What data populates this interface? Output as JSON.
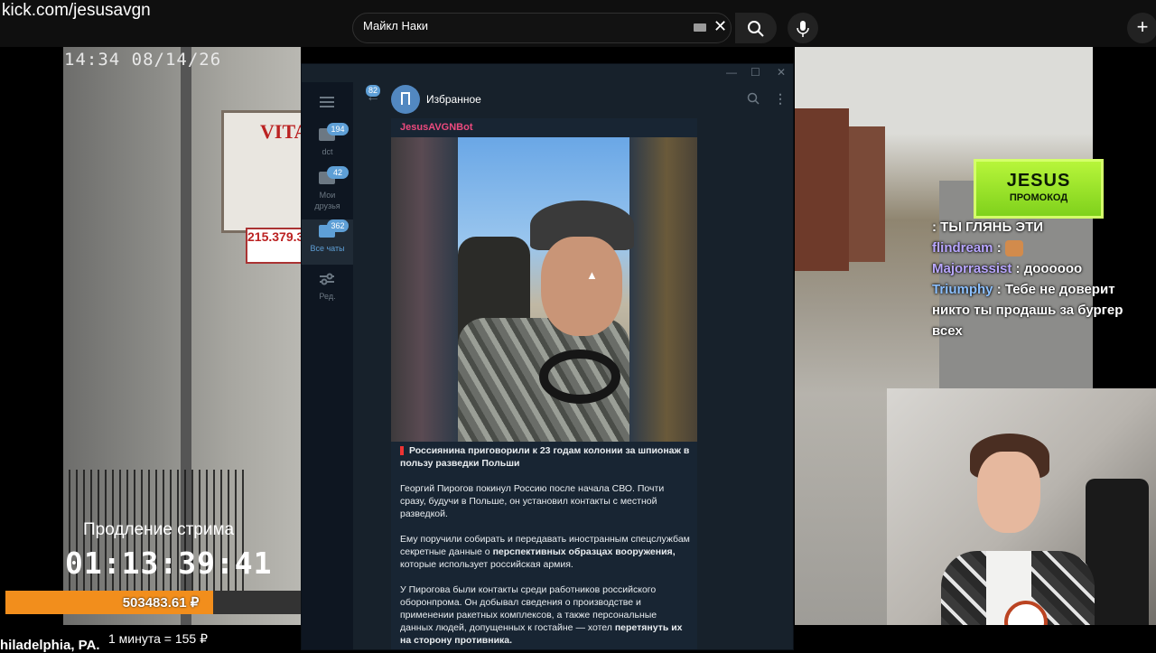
{
  "browser": {
    "url": "kick.com/jesusavgn",
    "search_value": "Майкл Наки"
  },
  "stream": {
    "timestamp": "14:34  08/14/26",
    "sign_text": "VITA\nH",
    "phone_sign": "215.379.3",
    "prolong_label": "Продление стрима",
    "prolong_timer": "01:13:39:41",
    "donation_amount": "503483.61 ₽",
    "donation_progress": 0.67,
    "location": "hiladelphia, PA.",
    "rate": "1 минута = 155 ₽",
    "accent": "#f28e1c"
  },
  "promo": {
    "title": "JESUS",
    "subtitle": "ПРОМОКОД"
  },
  "chat": {
    "lines": [
      {
        "user": "",
        "message": ": ТЫ ГЛЯНЬ ЭТИ"
      },
      {
        "user": "flindream",
        "message": ":"
      },
      {
        "user": "Majorrassist",
        "message": ": дoooooo"
      },
      {
        "user": "Triumphy",
        "message": ": Тебе не доверит никто ты продашь за бургер всех"
      }
    ]
  },
  "telegram": {
    "folders": [
      {
        "label": "dct",
        "badge": "194"
      },
      {
        "label": "Мои друзья",
        "badge": "42"
      },
      {
        "label": "Все чаты",
        "badge": "362"
      },
      {
        "label": "Ред.",
        "badge": ""
      }
    ],
    "back_badge": "82",
    "chat_title": "Избранное",
    "message": {
      "sender": "JesusAVGNBot",
      "headline": "Россиянина приговорили к 23 годам колонии за шпионаж в пользу разведки Польши",
      "p1": "Георгий Пирогов покинул Россию после начала СВО. Почти сразу, будучи в Польше, он установил контакты с местной разведкой.",
      "p2_a": "Ему поручили собирать и передавать иностранным спецслужбам секретные данные о ",
      "p2_b": "перспективных образцах вооружения,",
      "p2_c": " которые использует российская армия.",
      "p3_a": "У Пирогова были контакты среди работников российского оборонпрома. Он добывал сведения о производстве и применении ракетных комплексов, а также персональные данных людей, допущенных к гостайне — хотел ",
      "p3_b": "перетянуть их на сторону противника."
    }
  }
}
